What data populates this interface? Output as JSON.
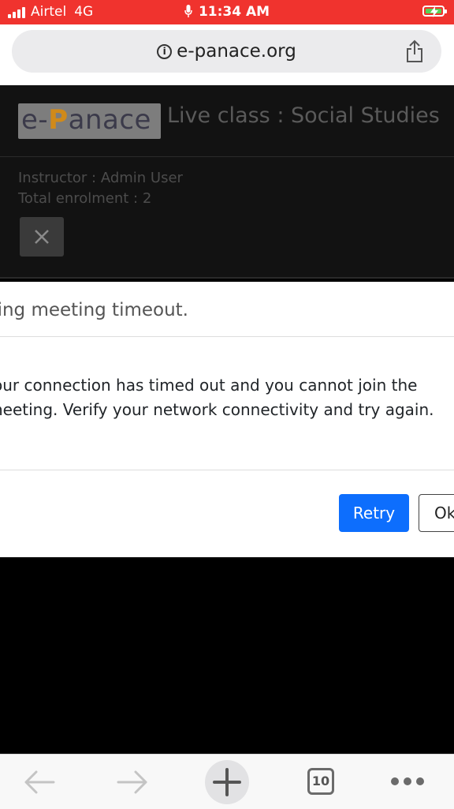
{
  "status_bar": {
    "carrier": "Airtel",
    "network": "4G",
    "time": "11:34 AM",
    "battery_color": "#55d357"
  },
  "browser": {
    "url": "e-panace.org",
    "info_icon_glyph": "i",
    "tab_count": "10"
  },
  "header": {
    "logo_text_prefix": "e-",
    "logo_text_p": "P",
    "logo_text_suffix": "anace",
    "class_title": "Live class : Social Studies"
  },
  "info": {
    "instructor": "Instructor : Admin User",
    "enrolment": "Total enrolment : 2"
  },
  "modal": {
    "title": "ning meeting timeout.",
    "body_line1": "our connection has timed out and you cannot join the",
    "body_line2": "neeting. Verify your network connectivity and try again.",
    "retry_label": "Retry",
    "ok_label": "Ok"
  },
  "colors": {
    "status_bar_bg": "#f0332e",
    "primary_button": "#0d6efd"
  }
}
